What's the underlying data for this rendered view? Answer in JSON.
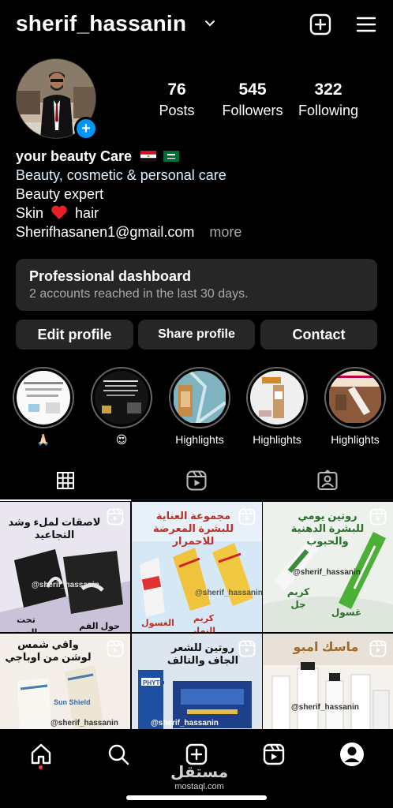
{
  "header": {
    "username": "sherif_hassanin",
    "icons": [
      "chevron-down-icon",
      "create-post-icon",
      "menu-icon"
    ]
  },
  "profile": {
    "stats": [
      {
        "value": "76",
        "label": "Posts"
      },
      {
        "value": "545",
        "label": "Followers"
      },
      {
        "value": "322",
        "label": "Following"
      }
    ],
    "bio": {
      "name": "your beauty Care",
      "category": "Beauty, cosmetic & personal care",
      "line1": "Beauty expert",
      "line2_a": "Skin",
      "line2_b": "hair",
      "email": "Sherifhasanen1@gmail.com",
      "more": "more"
    }
  },
  "dashboard": {
    "title": "Professional dashboard",
    "subtitle": "2 accounts reached in the last 30 days."
  },
  "buttons": {
    "edit": "Edit profile",
    "share": "Share profile",
    "contact": "Contact"
  },
  "highlights": [
    {
      "label": "🙏🏻"
    },
    {
      "label": "😍"
    },
    {
      "label": "Highlights"
    },
    {
      "label": "Highlights"
    },
    {
      "label": "Highlights"
    }
  ],
  "posts": [
    {
      "text": "لاصقات لملء وشد التجاعيد",
      "tag": "@sherif_hassanin",
      "sub1": "تحت العين",
      "sub2": "حول الفم"
    },
    {
      "text": "مجموعة العناية للبشرة المعرضة للاحمرار",
      "tag": "@sherif_hassanin",
      "sub1": "الغسول",
      "sub2": "كريم النهار"
    },
    {
      "text": "روتين يومي للبشرة الدهنية والحبوب",
      "tag": "@sherif_hassanin",
      "sub1": "كريم جل",
      "sub2": "غسول"
    },
    {
      "text": "واقي شمس لوشن من اوباجي",
      "tag": "@sherif_hassanin",
      "sub1": "Sun Shield",
      "sub2": ""
    },
    {
      "text": "روتين للشعر الجاف والتالف",
      "tag": "@sherif_hassanin",
      "sub1": "PHYTO",
      "sub2": ""
    },
    {
      "text": "ماسك امبو",
      "tag": "@sherif_hassanin",
      "sub1": "",
      "sub2": ""
    }
  ],
  "watermark": {
    "arabic": "مستقل",
    "latin": "mostaql.com"
  },
  "colors": {
    "accent": "#0095f6",
    "surface": "#262626",
    "muted": "#a8a8a8",
    "notify": "#ff3040"
  }
}
